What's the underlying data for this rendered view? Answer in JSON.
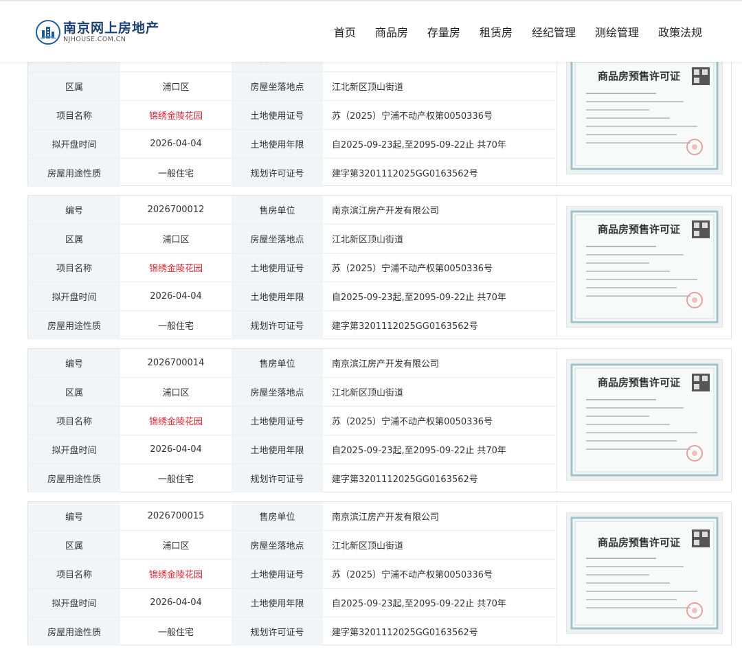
{
  "header": {
    "logo_title": "南京网上房地产",
    "logo_subtitle": "NJHOUSE.COM.CN",
    "nav": [
      "首页",
      "商品房",
      "存量房",
      "租赁房",
      "经纪管理",
      "测绘管理",
      "政策法规"
    ]
  },
  "labels": {
    "number": "编号",
    "district": "区属",
    "project_name": "项目名称",
    "open_date": "拟开盘时间",
    "usage": "房屋用途性质",
    "seller": "售房单位",
    "location": "房屋坐落地点",
    "land_cert": "土地使用证号",
    "land_term": "土地使用年限",
    "planning_permit": "规划许可证号"
  },
  "certificate": {
    "title": "商品房预售许可证"
  },
  "records": [
    {
      "number": "",
      "seller": "",
      "district": "浦口区",
      "location": "江北新区顶山街道",
      "project_name": "锦绣金陵花园",
      "land_cert": "苏（2025）宁浦不动产权第0050336号",
      "open_date": "2026-04-04",
      "land_term": "自2025-09-23起,至2095-09-22止 共70年",
      "usage": "一般住宅",
      "planning_permit": "建字第3201112025GG0163562号"
    },
    {
      "number": "2026700012",
      "seller": "南京滨江房产开发有限公司",
      "district": "浦口区",
      "location": "江北新区顶山街道",
      "project_name": "锦绣金陵花园",
      "land_cert": "苏（2025）宁浦不动产权第0050336号",
      "open_date": "2026-04-04",
      "land_term": "自2025-09-23起,至2095-09-22止 共70年",
      "usage": "一般住宅",
      "planning_permit": "建字第3201112025GG0163562号"
    },
    {
      "number": "2026700014",
      "seller": "南京滨江房产开发有限公司",
      "district": "浦口区",
      "location": "江北新区顶山街道",
      "project_name": "锦绣金陵花园",
      "land_cert": "苏（2025）宁浦不动产权第0050336号",
      "open_date": "2026-04-04",
      "land_term": "自2025-09-23起,至2095-09-22止 共70年",
      "usage": "一般住宅",
      "planning_permit": "建字第3201112025GG0163562号"
    },
    {
      "number": "2026700015",
      "seller": "南京滨江房产开发有限公司",
      "district": "浦口区",
      "location": "江北新区顶山街道",
      "project_name": "锦绣金陵花园",
      "land_cert": "苏（2025）宁浦不动产权第0050336号",
      "open_date": "2026-04-04",
      "land_term": "自2025-09-23起,至2095-09-22止 共70年",
      "usage": "一般住宅",
      "planning_permit": "建字第3201112025GG0163562号"
    }
  ],
  "colors": {
    "project_name": "#e0252f",
    "label_bg": "#f2f5f7",
    "logo": "#1a3f73"
  }
}
